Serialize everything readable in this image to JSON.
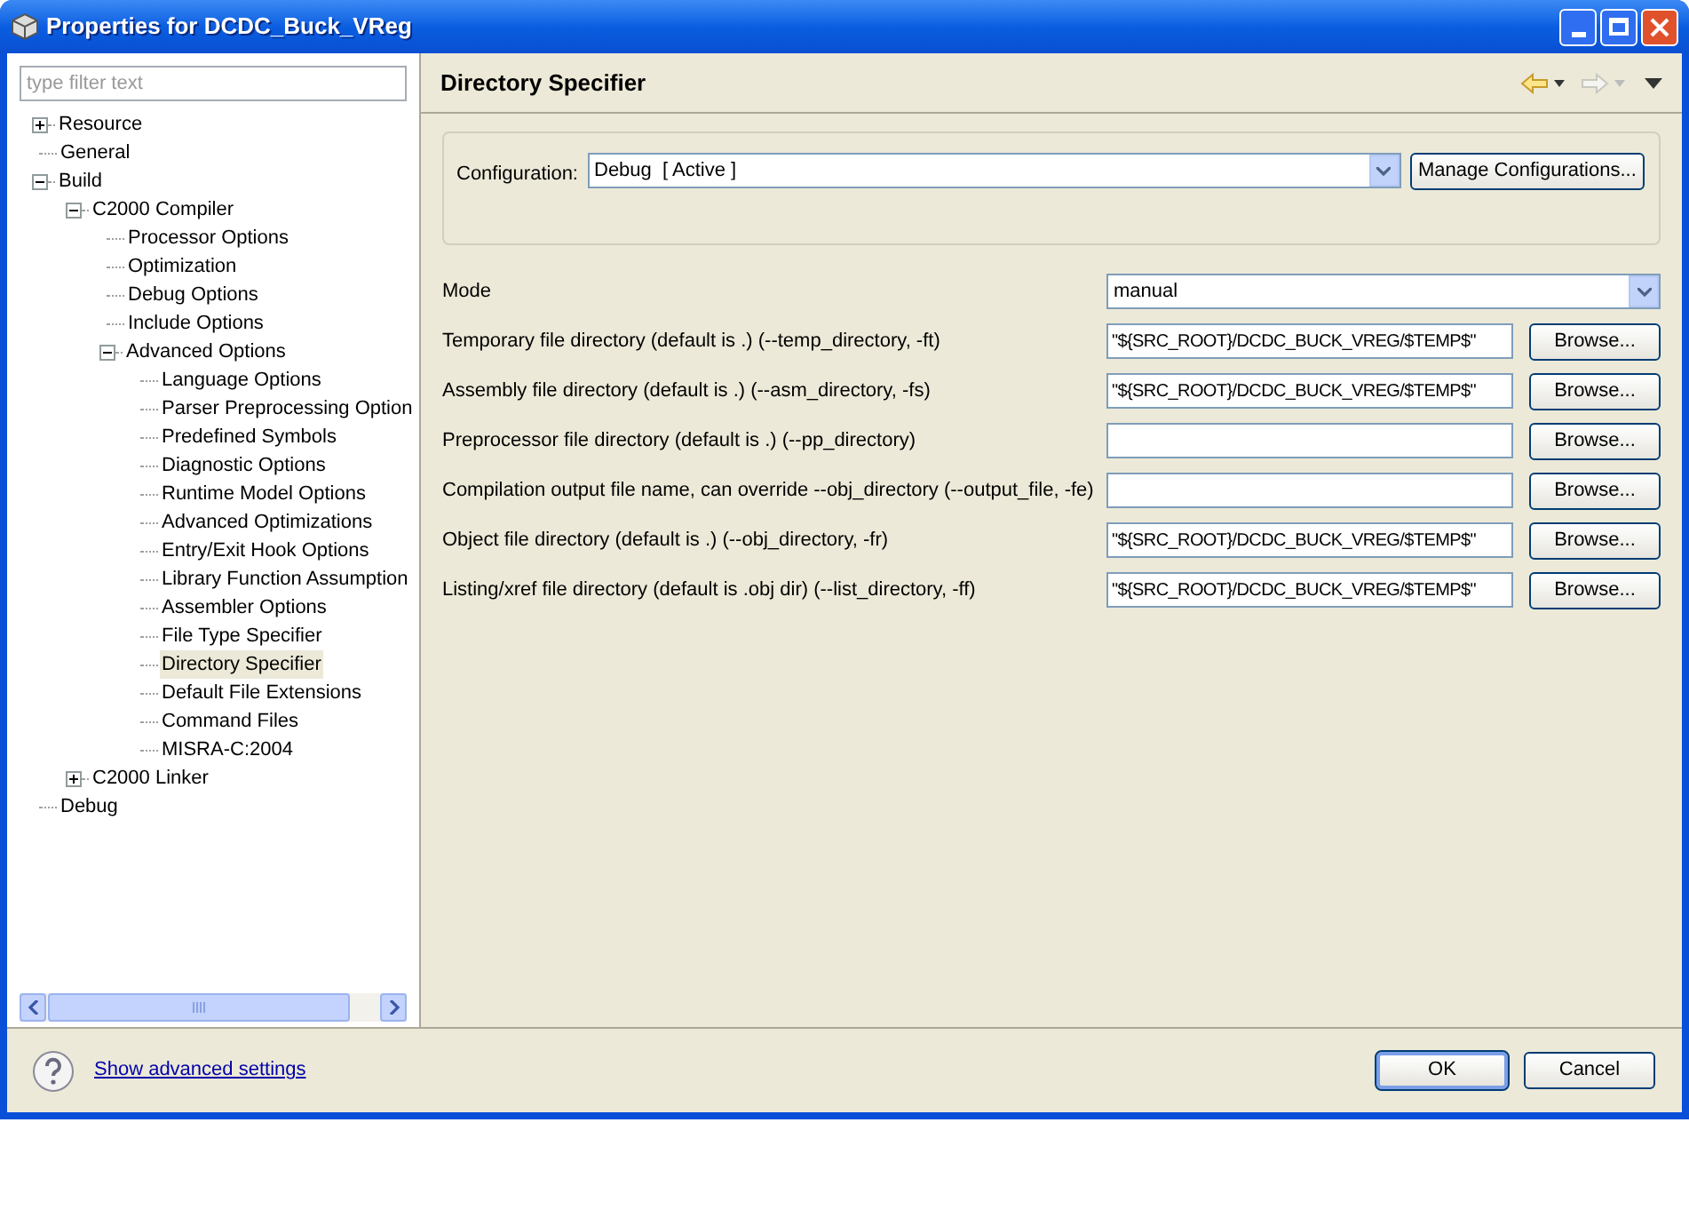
{
  "window": {
    "title": "Properties for DCDC_Buck_VReg"
  },
  "filter": {
    "placeholder": "type filter text"
  },
  "tree": [
    {
      "label": "Resource",
      "expanded": false,
      "selected": false
    },
    {
      "label": "General",
      "selected": false
    },
    {
      "label": "Build",
      "expanded": true,
      "selected": false,
      "children": [
        {
          "label": "C2000 Compiler",
          "expanded": true,
          "selected": false,
          "children": [
            {
              "label": "Processor Options",
              "selected": false
            },
            {
              "label": "Optimization",
              "selected": false
            },
            {
              "label": "Debug Options",
              "selected": false
            },
            {
              "label": "Include Options",
              "selected": false
            },
            {
              "label": "Advanced Options",
              "expanded": true,
              "selected": false,
              "children": [
                {
                  "label": "Language Options",
                  "selected": false
                },
                {
                  "label": "Parser Preprocessing Option",
                  "selected": false
                },
                {
                  "label": "Predefined Symbols",
                  "selected": false
                },
                {
                  "label": "Diagnostic Options",
                  "selected": false
                },
                {
                  "label": "Runtime Model Options",
                  "selected": false
                },
                {
                  "label": "Advanced Optimizations",
                  "selected": false
                },
                {
                  "label": "Entry/Exit Hook Options",
                  "selected": false
                },
                {
                  "label": "Library Function Assumption",
                  "selected": false
                },
                {
                  "label": "Assembler Options",
                  "selected": false
                },
                {
                  "label": "File Type Specifier",
                  "selected": false
                },
                {
                  "label": "Directory Specifier",
                  "selected": true
                },
                {
                  "label": "Default File Extensions",
                  "selected": false
                },
                {
                  "label": "Command Files",
                  "selected": false
                },
                {
                  "label": "MISRA-C:2004",
                  "selected": false
                }
              ]
            }
          ]
        },
        {
          "label": "C2000 Linker",
          "expanded": false,
          "selected": false
        }
      ]
    },
    {
      "label": "Debug",
      "selected": false
    }
  ],
  "page": {
    "title": "Directory Specifier"
  },
  "configuration": {
    "label": "Configuration:",
    "value": "Debug  [ Active ]",
    "button": "Manage Configurations..."
  },
  "mode": {
    "label": "Mode",
    "value": "manual"
  },
  "fields": [
    {
      "label": "Temporary file directory (default is .) (--temp_directory, -ft)",
      "value": "\"${SRC_ROOT}/DCDC_BUCK_VREG/$TEMP$\"",
      "button": "Browse..."
    },
    {
      "label": "Assembly file directory (default is .) (--asm_directory, -fs)",
      "value": "\"${SRC_ROOT}/DCDC_BUCK_VREG/$TEMP$\"",
      "button": "Browse..."
    },
    {
      "label": "Preprocessor file directory (default is .) (--pp_directory)",
      "button": "Browse..."
    },
    {
      "label": "Compilation output file name, can override --obj_directory (--output_file, -fe)",
      "button": "Browse..."
    },
    {
      "label": "Object file directory (default is .) (--obj_directory, -fr)",
      "value": "\"${SRC_ROOT}/DCDC_BUCK_VREG/$TEMP$\"",
      "button": "Browse..."
    },
    {
      "label": "Listing/xref file directory (default is .obj dir) (--list_directory, -ff)",
      "value": "\"${SRC_ROOT}/DCDC_BUCK_VREG/$TEMP$\"",
      "button": "Browse..."
    }
  ],
  "footer": {
    "link": "Show advanced settings",
    "buttons": [
      "OK",
      "Cancel"
    ]
  }
}
